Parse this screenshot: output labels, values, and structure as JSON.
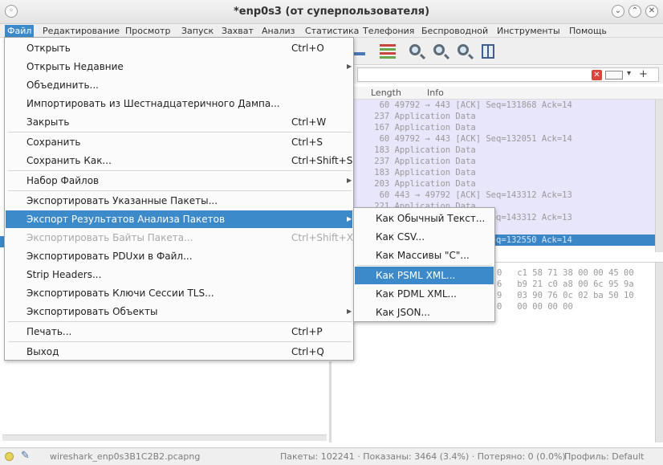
{
  "window": {
    "title": "*enp0s3 (от суперпользователя)"
  },
  "menubar": [
    {
      "label": "Файл",
      "active": true
    },
    {
      "label": "Редактирование"
    },
    {
      "label": "Просмотр"
    },
    {
      "label": "Запуск"
    },
    {
      "label": "Захват"
    },
    {
      "label": "Анализ"
    },
    {
      "label": "Статистика"
    },
    {
      "label": "Телефония"
    },
    {
      "label": "Беспроводной"
    },
    {
      "label": "Инструменты"
    },
    {
      "label": "Помощь"
    }
  ],
  "file_menu": [
    {
      "label": "Открыть",
      "shortcut": "Ctrl+O"
    },
    {
      "label": "Открыть Недавние",
      "submenu": true
    },
    {
      "label": "Объединить..."
    },
    {
      "label": "Импортировать из Шестнадцатеричного Дампа..."
    },
    {
      "label": "Закрыть",
      "shortcut": "Ctrl+W"
    },
    {
      "label": "Сохранить",
      "shortcut": "Ctrl+S"
    },
    {
      "label": "Сохранить Как...",
      "shortcut": "Ctrl+Shift+S"
    },
    {
      "label": "Набор Файлов",
      "submenu": true
    },
    {
      "label": "Экспортировать Указанные Пакеты..."
    },
    {
      "label": "Экспорт Результатов Анализа Пакетов",
      "submenu": true,
      "highlighted": true
    },
    {
      "label": "Экспортировать Байты Пакета...",
      "shortcut": "Ctrl+Shift+X",
      "disabled": true
    },
    {
      "label": "Экспортировать PDUxи в Файл..."
    },
    {
      "label": "Strip Headers..."
    },
    {
      "label": "Экспортировать Ключи Сессии TLS..."
    },
    {
      "label": "Экспортировать Объекты",
      "submenu": true
    },
    {
      "label": "Печать...",
      "shortcut": "Ctrl+P"
    },
    {
      "label": "Выход",
      "shortcut": "Ctrl+Q"
    }
  ],
  "export_submenu": [
    {
      "label": "Как Обычный Текст..."
    },
    {
      "label": "Как CSV..."
    },
    {
      "label": "Как Массивы \"C\"..."
    },
    {
      "label": "Как PSML XML...",
      "highlighted": true
    },
    {
      "label": "Как PDML XML..."
    },
    {
      "label": "Как JSON..."
    }
  ],
  "packet_list": {
    "headers": [
      "Length",
      "Info"
    ],
    "rows": [
      "     60 49792 → 443 [ACK] Seq=131868 Ack=14",
      "    237 Application Data",
      "    167 Application Data",
      "     60 49792 → 443 [ACK] Seq=132051 Ack=14",
      "    183 Application Data",
      "    237 Application Data",
      "    183 Application Data",
      "    203 Application Data",
      "     60 443 → 49792 [ACK] Seq=143312 Ack=13",
      "    221 Application Data",
      "     60 443 → 49792 [ACK] Seq=143312 Ack=13",
      "    183 Application Data",
      "     60 49792 → 443 [ACK] Seq=132550 Ack=14"
    ]
  },
  "hex_dump": [
    "0   c1 58 71 38 00 00 45 00",
    "6   b9 21 c0 a8 00 6c 95 9a",
    "9   03 90 76 0c 02 ba 50 10",
    "0   00 00 00 00"
  ],
  "statusbar": {
    "file": "wireshark_enp0s3B1C2B2.pcapng",
    "stats": "Пакеты: 102241 · Показаны: 3464 (3.4%) · Потеряно: 0 (0.0%)",
    "profile": "Профиль: Default"
  }
}
